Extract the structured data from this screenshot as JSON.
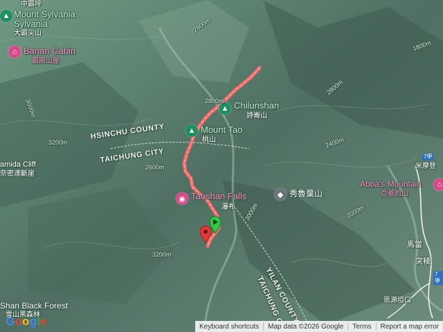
{
  "map": {
    "peaks": [
      {
        "name_en": "Mount Sylvania",
        "name_zh": "大霸尖山"
      },
      {
        "name_en": "Chilunshan",
        "name_zh": "詩崙山"
      },
      {
        "name_en": "Mount Tao",
        "name_zh": "桃山"
      }
    ],
    "places": [
      {
        "name_en": "Banan Cabin",
        "name_zh": "霸南山屋"
      },
      {
        "name_en": "Taoshan Falls",
        "name_zh": "瀑布"
      },
      {
        "name_en": "Abba's Mountain",
        "name_zh": "亞爸的山"
      },
      {
        "name_en": "Shan Black Forest",
        "name_zh": "雪山黑森林"
      }
    ],
    "other_labels": {
      "top_left": "中霸坪",
      "bunker": "amida Cliff",
      "bunker_zh": "奈密達斷崖",
      "xiuluye": "秀魯葉山",
      "mimodeng": "米摩登",
      "madang": "馬當",
      "tuling": "突稜",
      "siyuan": "思源埡口"
    },
    "counties": [
      "HSINCHU COUNTY",
      "TAICHUNG CITY",
      "YILAN COUNTY",
      "TAICHUNG C"
    ],
    "road_shields": [
      "7甲",
      "7甲"
    ],
    "contour_labels": [
      "2800m",
      "3000m",
      "2800m",
      "2400m",
      "1800m",
      "3200m",
      "3000m",
      "2600m",
      "2000m",
      "3200m",
      "2800m"
    ],
    "colors": {
      "route": "#ff6b6b",
      "start_marker": "#2ecc40",
      "end_marker": "#e53935"
    }
  },
  "footer": {
    "logo": "Google",
    "shortcuts": "Keyboard shortcuts",
    "map_data": "Map data ©2026 Google",
    "terms": "Terms",
    "report": "Report a map error"
  }
}
